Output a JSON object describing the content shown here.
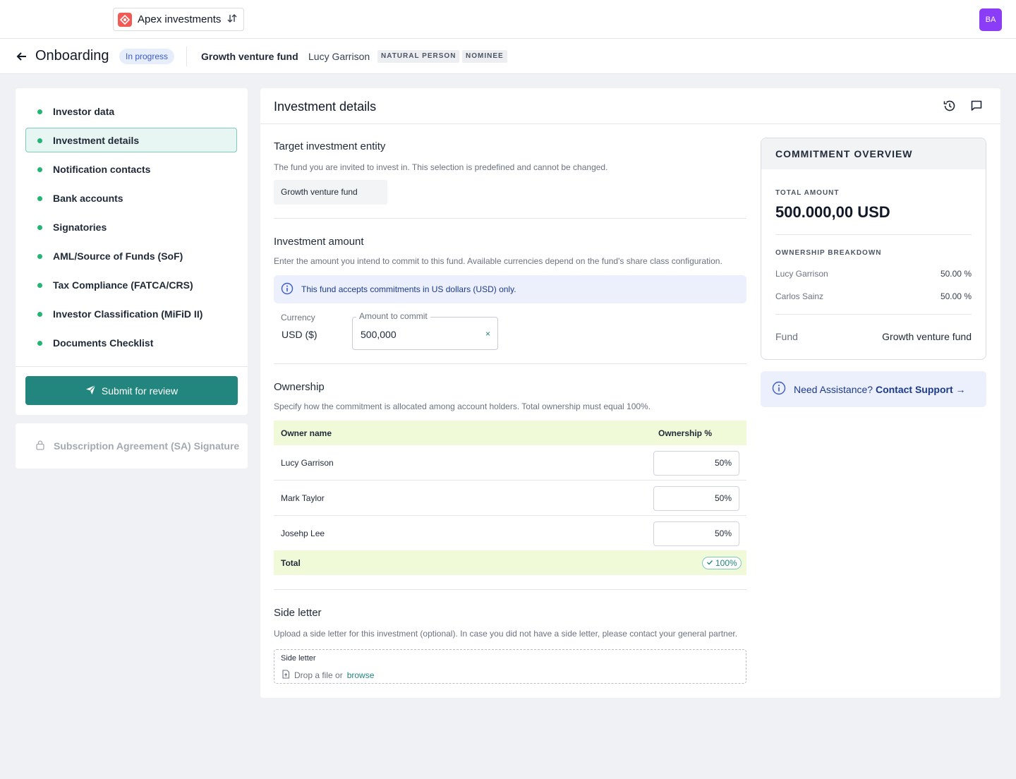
{
  "topbar": {
    "org_name": "Apex investments",
    "avatar_initials": "BA"
  },
  "subheader": {
    "title": "Onboarding",
    "status": "In progress",
    "fund": "Growth venture fund",
    "investor": "Lucy Garrison",
    "tags": [
      "NATURAL PERSON",
      "NOMINEE"
    ]
  },
  "nav": {
    "items": [
      {
        "label": "Investor data"
      },
      {
        "label": "Investment details"
      },
      {
        "label": "Notification contacts"
      },
      {
        "label": "Bank accounts"
      },
      {
        "label": "Signatories"
      },
      {
        "label": "AML/Source of Funds (SoF)"
      },
      {
        "label": "Tax Compliance (FATCA/CRS)"
      },
      {
        "label": "Investor Classification (MiFiD II)"
      },
      {
        "label": "Documents Checklist"
      }
    ],
    "active_index": 1,
    "status_color": "#22b573",
    "submit_label": "Submit for review",
    "sa_label": "Subscription Agreement (SA) Signature"
  },
  "main": {
    "title": "Investment details",
    "target": {
      "title": "Target investment entity",
      "desc": "The fund you are invited to invest in. This selection is predefined and cannot be changed.",
      "value": "Growth venture fund"
    },
    "amount": {
      "title": "Investment amount",
      "desc": "Enter the amount you intend to commit to this fund. Available currencies depend on the fund's share class configuration.",
      "info": "This fund accepts commitments in US dollars (USD) only.",
      "currency_label": "Currency",
      "currency_value": "USD ($)",
      "amount_label": "Amount to commit",
      "amount_value": "500,000",
      "clear": "×"
    },
    "ownership": {
      "title": "Ownership",
      "desc": "Specify how the commitment is allocated among account holders. Total ownership must equal 100%.",
      "col_name": "Owner name",
      "col_pct": "Ownership %",
      "rows": [
        {
          "name": "Lucy Garrison",
          "pct": "50%"
        },
        {
          "name": "Mark Taylor",
          "pct": "50%"
        },
        {
          "name": "Josehp Lee",
          "pct": "50%"
        }
      ],
      "total_label": "Total",
      "total_value": "100%"
    },
    "side_letter": {
      "title": "Side letter",
      "desc": "Upload a side letter for this investment (optional). In case you did not have a side letter, please contact your general partner.",
      "field_label": "Side letter",
      "drop_text": "Drop a file or",
      "browse": "browse"
    }
  },
  "overview": {
    "title": "COMMITMENT OVERVIEW",
    "total_label": "TOTAL AMOUNT",
    "total": "500.000,00 USD",
    "breakdown_label": "OWNERSHIP BREAKDOWN",
    "breakdown": [
      {
        "name": "Lucy Garrison",
        "pct": "50.00 %"
      },
      {
        "name": "Carlos Sainz",
        "pct": "50.00 %"
      }
    ],
    "fund_label": "Fund",
    "fund_value": "Growth venture fund"
  },
  "assist": {
    "text": "Need Assistance?",
    "link": "Contact Support →"
  },
  "colors": {
    "accent": "#22857e",
    "avatar": "#8b3cf7",
    "logo": "#f25a55"
  }
}
